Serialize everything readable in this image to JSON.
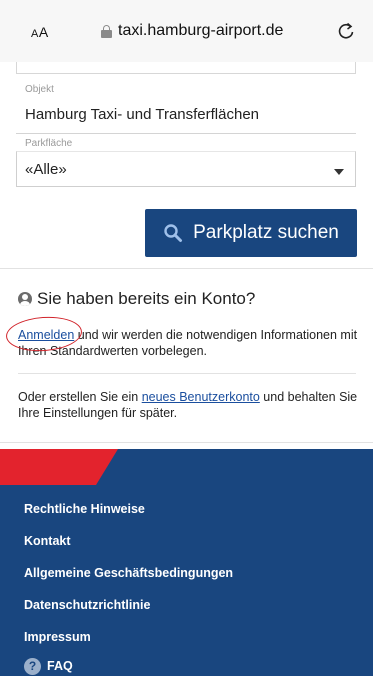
{
  "browser": {
    "text_size_label": "AA",
    "url": "taxi.hamburg-airport.de"
  },
  "form": {
    "object_label": "Objekt",
    "object_value": "Hamburg Taxi- und Transferflächen",
    "parking_label": "Parkfläche",
    "parking_value": "«Alle»",
    "search_button": "Parkplatz suchen"
  },
  "account": {
    "title": "Sie haben bereits ein Konto?",
    "login_link": "Anmelden",
    "login_text": " und wir werden die notwendigen Informationen mit Ihren Standardwerten vorbelegen.",
    "create_prefix": "Oder erstellen Sie ein ",
    "create_link": "neues Benutzerkonto",
    "create_suffix": " und behalten Sie Ihre Einstellungen für später."
  },
  "footer": {
    "links": [
      "Rechtliche Hinweise",
      "Kontakt",
      "Allgemeine Geschäftsbedingungen",
      "Datenschutzrichtlinie",
      "Impressum"
    ],
    "faq": "FAQ"
  },
  "colors": {
    "brand_blue": "#19467f",
    "brand_red": "#e3232d",
    "annotation_red": "#d1232a",
    "link_blue": "#1a4e9e"
  }
}
